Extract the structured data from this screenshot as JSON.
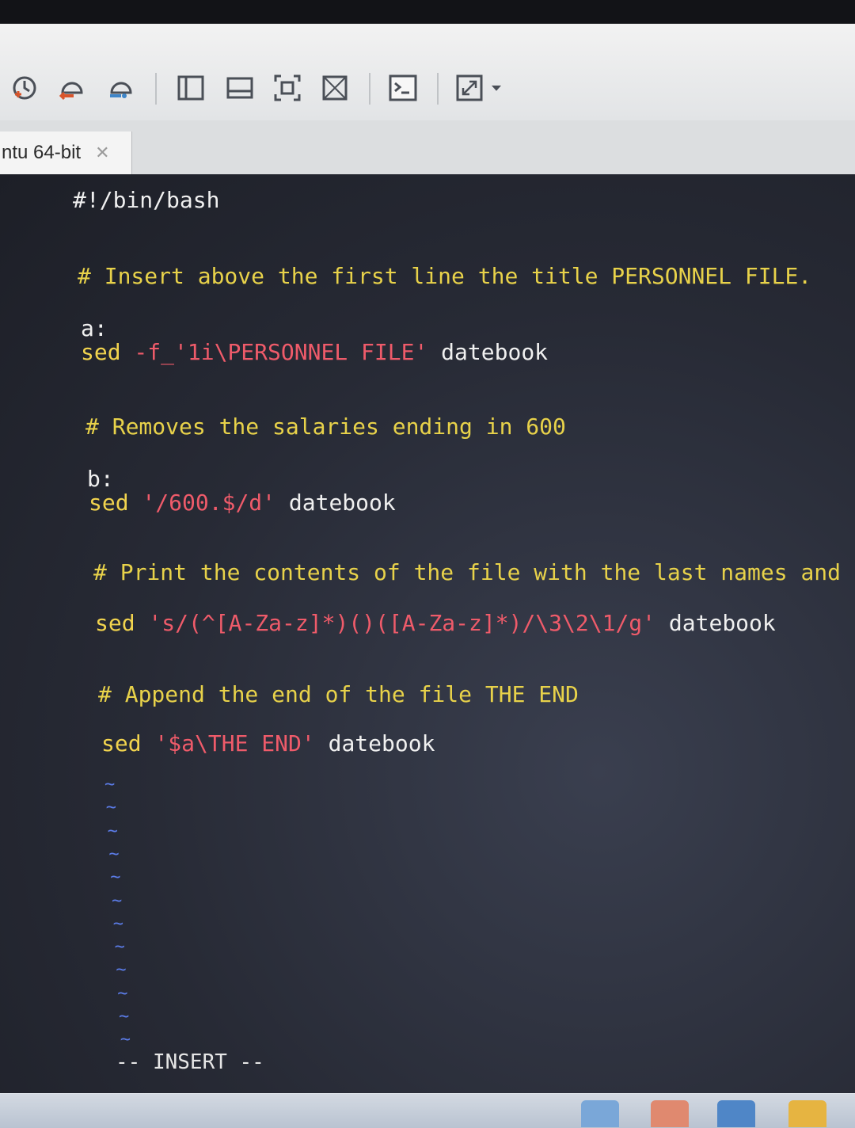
{
  "tab": {
    "label": "ntu 64-bit",
    "close_glyph": "✕"
  },
  "toolbar": {
    "icons": [
      "take-snapshot-icon",
      "restore-snapshot-icon",
      "snapshot-manager-icon",
      "show-library-icon",
      "show-thumbnail-bar-icon",
      "full-screen-icon",
      "unity-view-icon",
      "console-view-icon",
      "stretch-guest-icon",
      "dropdown-arrow-icon"
    ]
  },
  "editor": {
    "lines": [
      {
        "parts": [
          {
            "t": "#!/bin/bash",
            "c": "plain"
          }
        ]
      },
      {
        "parts": [
          {
            "t": "# Insert above the first line the title PERSONNEL FILE.",
            "c": "comment"
          }
        ]
      },
      {
        "parts": [
          {
            "t": "a:",
            "c": "plain"
          }
        ]
      },
      {
        "parts": [
          {
            "t": "sed",
            "c": "kw"
          },
          {
            "t": " -f_",
            "c": "str"
          },
          {
            "t": "'1i\\PERSONNEL FILE'",
            "c": "str"
          },
          {
            "t": " datebook",
            "c": "plain"
          }
        ]
      },
      {
        "parts": [
          {
            "t": "# Removes the salaries ending in 600",
            "c": "comment"
          }
        ]
      },
      {
        "parts": [
          {
            "t": "b:",
            "c": "plain"
          }
        ]
      },
      {
        "parts": [
          {
            "t": "sed",
            "c": "kw"
          },
          {
            "t": " '/600.$/d'",
            "c": "str"
          },
          {
            "t": " datebook",
            "c": "plain"
          }
        ]
      },
      {
        "parts": [
          {
            "t": "# Print the contents of the file with the last names and first n",
            "c": "comment"
          }
        ]
      },
      {
        "parts": [
          {
            "t": "sed",
            "c": "kw"
          },
          {
            "t": " 's/(^[A-Za-z]*)()([A-Za-z]*)/\\3\\2\\1/g'",
            "c": "str"
          },
          {
            "t": " datebook",
            "c": "plain"
          }
        ]
      },
      {
        "parts": [
          {
            "t": "# Append the end of the file THE END",
            "c": "comment"
          }
        ]
      },
      {
        "parts": [
          {
            "t": "sed",
            "c": "kw"
          },
          {
            "t": " '$a\\THE END'",
            "c": "str"
          },
          {
            "t": " datebook",
            "c": "plain"
          }
        ]
      }
    ],
    "tilde": "~",
    "tilde_count": 12,
    "mode": "-- INSERT --"
  }
}
